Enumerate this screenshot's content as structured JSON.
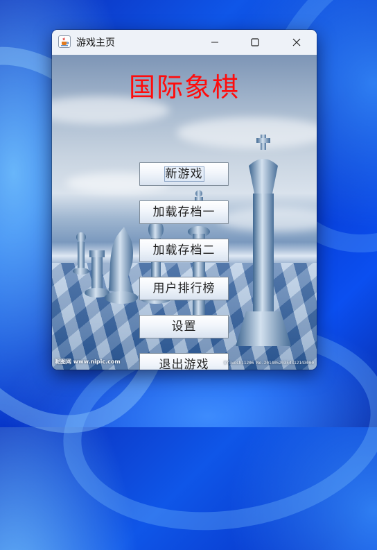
{
  "window": {
    "title": "游戏主页",
    "icon": "java-cup-icon",
    "controls": [
      "minimize-icon",
      "maximize-icon",
      "close-icon"
    ]
  },
  "game_title": "国际象棋",
  "menu": [
    "新游戏",
    "加载存档一",
    "加载存档二",
    "用户排行榜",
    "设置",
    "退出游戏"
  ],
  "background_image": "chess-pieces-on-checkered-floor",
  "watermark": {
    "left": "昵图网 www.nipic.com",
    "right": "BY:woshi1206 No.20140520354312143000"
  },
  "colors": {
    "title_red": "#ff0c0c",
    "desktop_blue": "#0f56e8"
  }
}
